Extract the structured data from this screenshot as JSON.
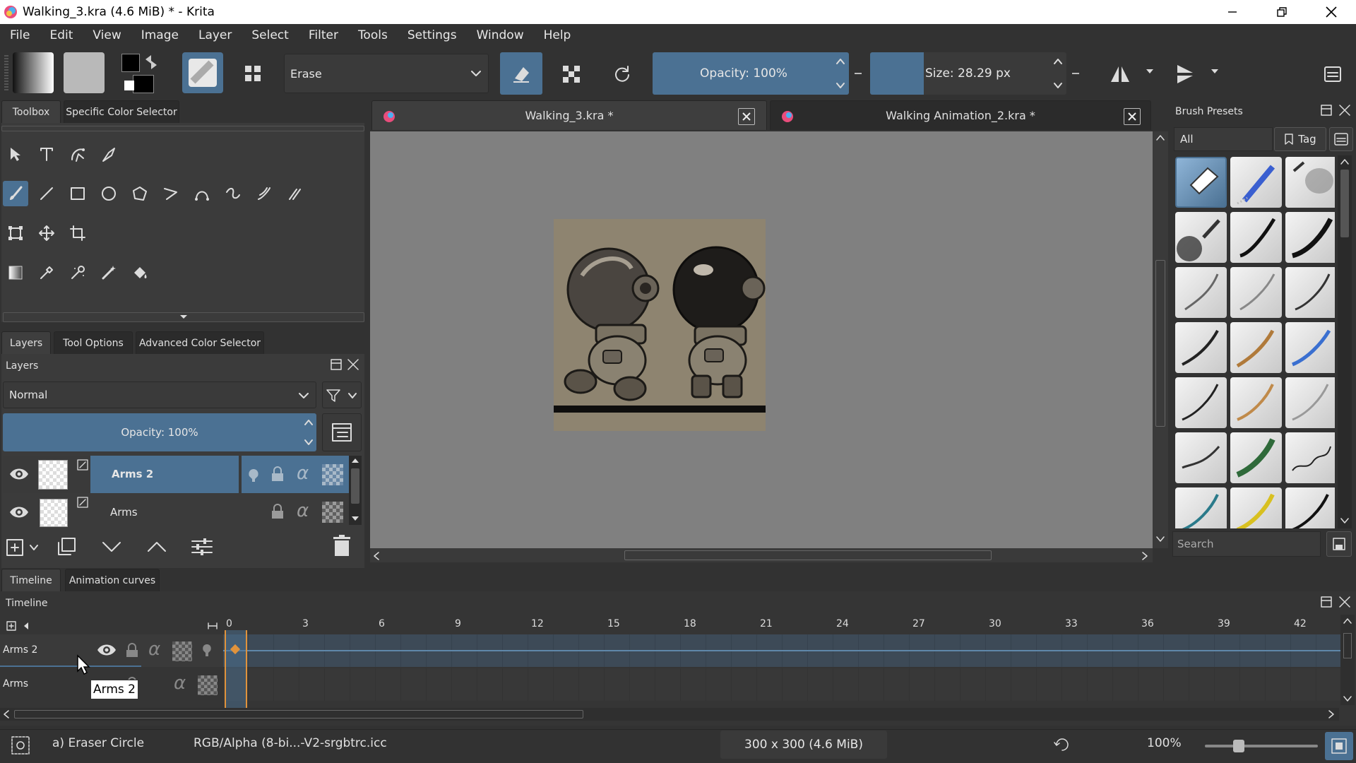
{
  "window": {
    "title": "Walking_3.kra (4.6 MiB)  * - Krita"
  },
  "menu": [
    "File",
    "Edit",
    "View",
    "Image",
    "Layer",
    "Select",
    "Filter",
    "Tools",
    "Settings",
    "Window",
    "Help"
  ],
  "toolbar": {
    "brush_preset_name": "Erase",
    "opacity_label": "Opacity: 100%",
    "opacity_value": 1.0,
    "size_label": "Size: 28.29 px",
    "size_value": 28.29
  },
  "toolbox": {
    "tabs": [
      "Toolbox",
      "Specific Color Selector"
    ]
  },
  "layers_docker": {
    "tabs": [
      "Layers",
      "Tool Options",
      "Advanced Color Selector"
    ],
    "title": "Layers",
    "blend_mode": "Normal",
    "opacity_label": "Opacity:  100%",
    "layers": [
      {
        "name": "Arms 2",
        "selected": true
      },
      {
        "name": "Arms",
        "selected": false
      }
    ]
  },
  "documents": {
    "tabs": [
      {
        "name": "Walking_3.kra *",
        "active": true
      },
      {
        "name": "Walking Animation_2.kra *",
        "active": false
      }
    ]
  },
  "brush_presets": {
    "title": "Brush Presets",
    "filter": "All",
    "tag_label": "Tag",
    "search_placeholder": "Search"
  },
  "timeline": {
    "tabs": [
      "Timeline",
      "Animation curves"
    ],
    "title": "Timeline",
    "frame_numbers": [
      "0",
      "3",
      "6",
      "9",
      "12",
      "15",
      "18",
      "21",
      "24",
      "27",
      "30",
      "33",
      "36",
      "39",
      "42"
    ],
    "rows": [
      {
        "name": "Arms 2"
      },
      {
        "name": "Arms"
      }
    ],
    "tooltip": "Arms 2"
  },
  "statusbar": {
    "brush": "a) Eraser Circle",
    "color_profile": "RGB/Alpha (8-bi...-V2-srgbtrc.icc",
    "dimensions": "300 x 300 (4.6 MiB)",
    "zoom": "100%"
  },
  "colors": {
    "accent": "#4b7193",
    "panel": "#323232",
    "canvas_bg": "#808080",
    "keyframe": "#e0933c"
  }
}
